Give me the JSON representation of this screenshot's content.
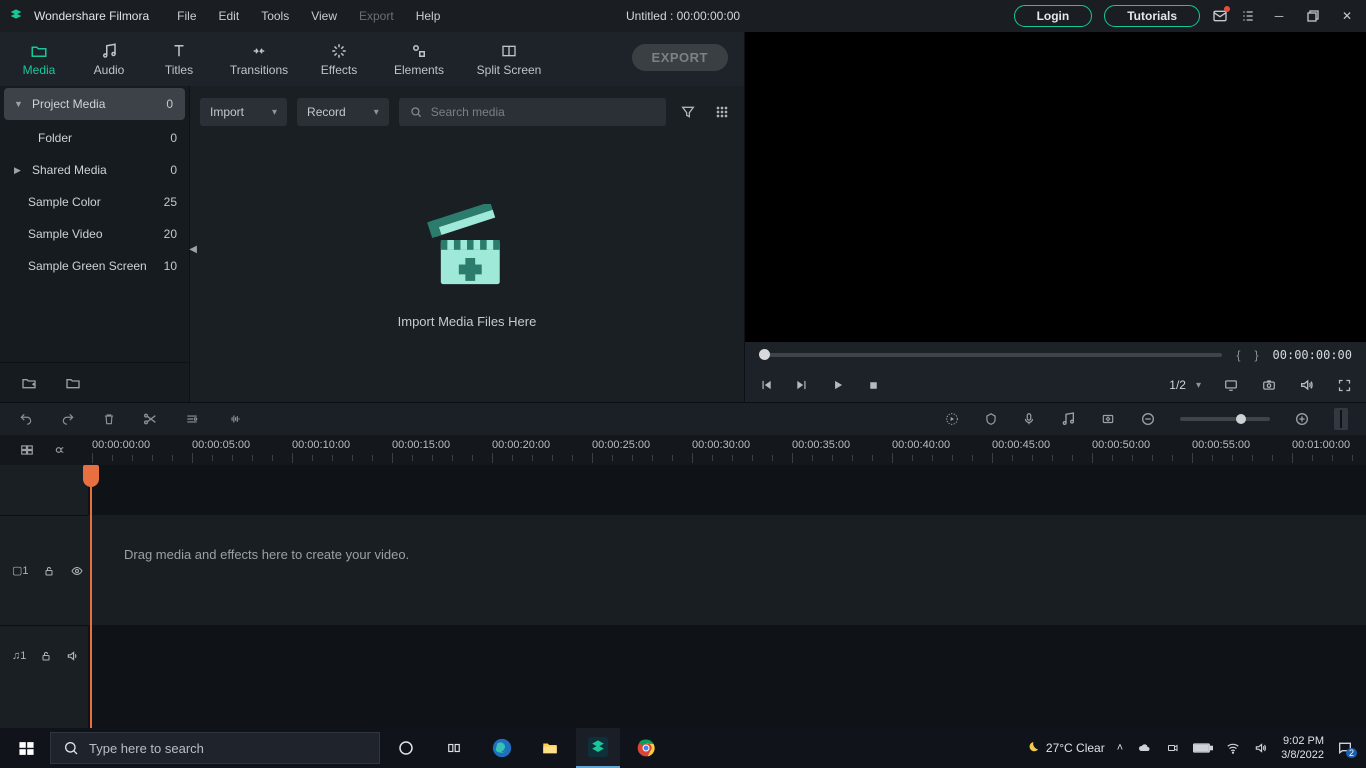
{
  "menubar": {
    "brand": "Wondershare Filmora",
    "items": [
      "File",
      "Edit",
      "Tools",
      "View",
      "Export",
      "Help"
    ],
    "disabled_index": 4,
    "title": "Untitled : 00:00:00:00",
    "login": "Login",
    "tutorials": "Tutorials"
  },
  "tabs": {
    "items": [
      "Media",
      "Audio",
      "Titles",
      "Transitions",
      "Effects",
      "Elements",
      "Split Screen"
    ],
    "active_index": 0,
    "export": "EXPORT"
  },
  "sidebar": {
    "items": [
      {
        "label": "Project Media",
        "count": "0",
        "caret": "▼",
        "selected": true
      },
      {
        "label": "Folder",
        "count": "0",
        "sub": true
      },
      {
        "label": "Shared Media",
        "count": "0",
        "caret": "▶"
      },
      {
        "label": "Sample Color",
        "count": "25"
      },
      {
        "label": "Sample Video",
        "count": "20"
      },
      {
        "label": "Sample Green Screen",
        "count": "10"
      }
    ]
  },
  "mediatoolbar": {
    "import": "Import",
    "record": "Record",
    "search_placeholder": "Search media"
  },
  "dropzone": {
    "text": "Import Media Files Here"
  },
  "preview": {
    "brace_open": "{",
    "brace_close": "}",
    "timecode": "00:00:00:00",
    "ratio": "1/2"
  },
  "timeline": {
    "labels": [
      "00:00:00:00",
      "00:00:05:00",
      "00:00:10:00",
      "00:00:15:00",
      "00:00:20:00",
      "00:00:25:00",
      "00:00:30:00",
      "00:00:35:00",
      "00:00:40:00",
      "00:00:45:00",
      "00:00:50:00",
      "00:00:55:00",
      "00:01:00:00"
    ],
    "track_video_id": "▢1",
    "track_audio_id": "♫1",
    "placeholder": "Drag media and effects here to create your video."
  },
  "taskbar": {
    "search_placeholder": "Type here to search",
    "weather": "27°C  Clear",
    "time": "9:02 PM",
    "date": "3/8/2022"
  }
}
